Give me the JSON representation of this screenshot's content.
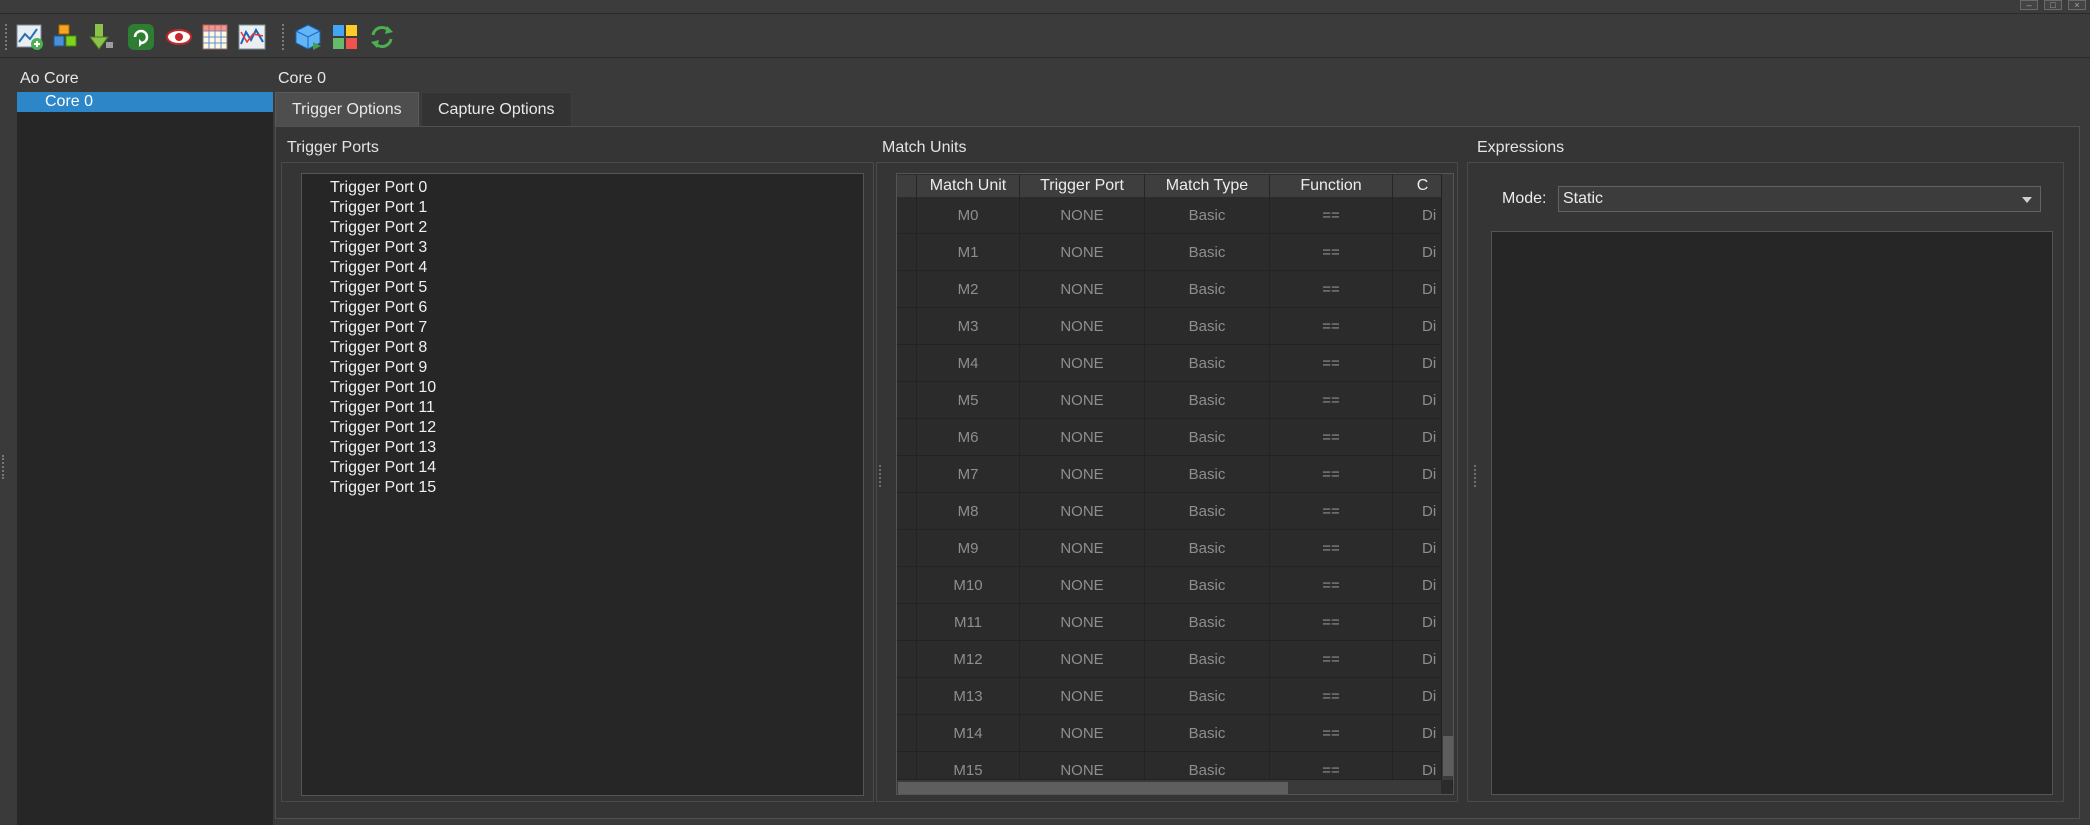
{
  "sidebar": {
    "title": "Ao Core",
    "items": [
      {
        "label": "Core 0",
        "selected": true
      }
    ]
  },
  "main": {
    "core_title": "Core 0",
    "tabs": [
      {
        "label": "Trigger Options",
        "active": true
      },
      {
        "label": "Capture Options",
        "active": false
      }
    ]
  },
  "trigger_ports": {
    "label": "Trigger Ports",
    "items": [
      "Trigger Port 0",
      "Trigger Port 1",
      "Trigger Port 2",
      "Trigger Port 3",
      "Trigger Port 4",
      "Trigger Port 5",
      "Trigger Port 6",
      "Trigger Port 7",
      "Trigger Port 8",
      "Trigger Port 9",
      "Trigger Port 10",
      "Trigger Port 11",
      "Trigger Port 12",
      "Trigger Port 13",
      "Trigger Port 14",
      "Trigger Port 15"
    ]
  },
  "match_units": {
    "label": "Match Units",
    "columns": [
      "Match Unit",
      "Trigger Port",
      "Match Type",
      "Function",
      "C"
    ],
    "rows": [
      [
        "M0",
        "NONE",
        "Basic",
        "==",
        "Di"
      ],
      [
        "M1",
        "NONE",
        "Basic",
        "==",
        "Di"
      ],
      [
        "M2",
        "NONE",
        "Basic",
        "==",
        "Di"
      ],
      [
        "M3",
        "NONE",
        "Basic",
        "==",
        "Di"
      ],
      [
        "M4",
        "NONE",
        "Basic",
        "==",
        "Di"
      ],
      [
        "M5",
        "NONE",
        "Basic",
        "==",
        "Di"
      ],
      [
        "M6",
        "NONE",
        "Basic",
        "==",
        "Di"
      ],
      [
        "M7",
        "NONE",
        "Basic",
        "==",
        "Di"
      ],
      [
        "M8",
        "NONE",
        "Basic",
        "==",
        "Di"
      ],
      [
        "M9",
        "NONE",
        "Basic",
        "==",
        "Di"
      ],
      [
        "M10",
        "NONE",
        "Basic",
        "==",
        "Di"
      ],
      [
        "M11",
        "NONE",
        "Basic",
        "==",
        "Di"
      ],
      [
        "M12",
        "NONE",
        "Basic",
        "==",
        "Di"
      ],
      [
        "M13",
        "NONE",
        "Basic",
        "==",
        "Di"
      ],
      [
        "M14",
        "NONE",
        "Basic",
        "==",
        "Di"
      ],
      [
        "M15",
        "NONE",
        "Basic",
        "==",
        "Di"
      ]
    ]
  },
  "expressions": {
    "label": "Expressions",
    "mode_label": "Mode:",
    "mode_value": "Static"
  },
  "toolbar": {
    "icons": [
      "chart-add-icon",
      "cube-stack-icon",
      "download-arrow-icon",
      "loop-icon",
      "eye-icon",
      "grid-table-icon",
      "waveform-icon",
      "cube-export-icon",
      "module-grid-icon",
      "refresh-icon"
    ]
  },
  "colors": {
    "selection": "#2c86c8",
    "background": "#3a3a3a",
    "panel": "#262626"
  }
}
